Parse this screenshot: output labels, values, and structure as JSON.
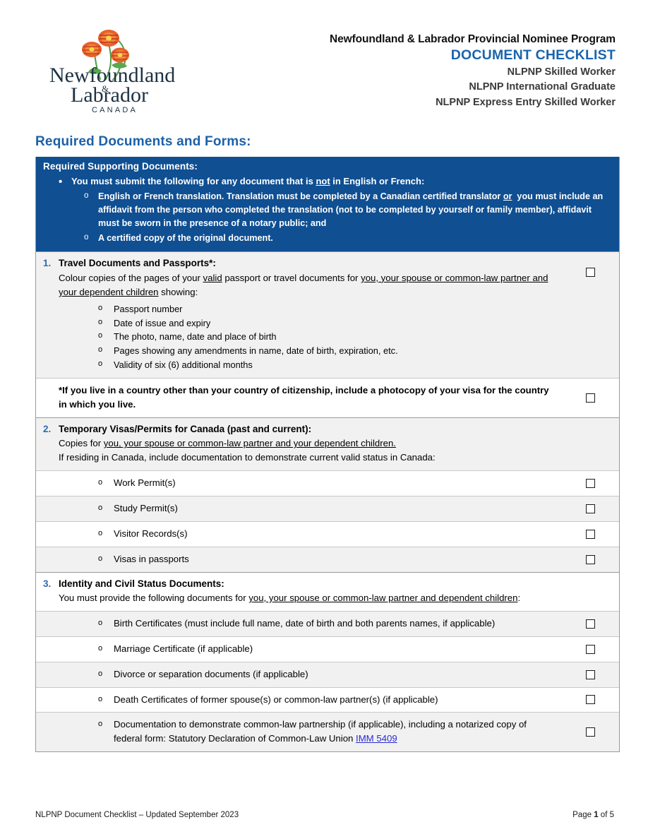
{
  "header": {
    "logo_alt": "Newfoundland & Labrador Canada",
    "logo_line1": "Newfoundland",
    "logo_amp": "&",
    "logo_line2": "Labrador",
    "logo_country": "CANADA",
    "program_title": "Newfoundland & Labrador Provincial Nominee Program",
    "doc_title": "DOCUMENT CHECKLIST",
    "streams": [
      "NLPNP Skilled Worker",
      "NLPNP International Graduate",
      "NLPNP Express Entry Skilled Worker"
    ]
  },
  "section_heading": "Required Documents and Forms:",
  "blue_box": {
    "title": "Required Supporting Documents:",
    "bullet": "You must submit the following for any document that is not in English or French:",
    "bullet_underline": "not",
    "sub_items": [
      "English or French translation. Translation must be completed by a Canadian certified translator or  you must include an affidavit from the person who completed the translation (not to be completed by yourself or family member), affidavit must be sworn in the presence of a notary public; and",
      "A certified copy of the original document."
    ]
  },
  "sections": [
    {
      "num": "1.",
      "title": "Travel Documents and Passports*:",
      "body_pre": "Colour copies of the pages of your ",
      "body_u1": "valid",
      "body_mid": " passport or travel documents for ",
      "body_u2": "you, your spouse or common-law partner and your dependent children",
      "body_post": " showing:",
      "sub_list": [
        "Passport number",
        "Date of issue and expiry",
        "The photo, name, date and place of birth",
        "Pages showing any amendments in name, date of birth, expiration, etc.",
        "Validity of six (6) additional months"
      ]
    },
    {
      "num": "2.",
      "title": "Temporary Visas/Permits for Canada (past and current):",
      "line1_pre": "Copies for ",
      "line1_u": "you, your spouse or common-law partner and your dependent children.",
      "line2": "If residing in Canada, include documentation to demonstrate current valid status in Canada:"
    },
    {
      "num": "3.",
      "title": "Identity and Civil Status Documents:",
      "body_pre": "You must provide the following documents for ",
      "body_u": "you, your spouse or common-law partner and dependent children",
      "body_post": ":"
    }
  ],
  "note_row": {
    "text": "*If you live in a country other than your country of citizenship, include a photocopy of your visa for the country in which you live."
  },
  "section2_items": [
    "Work Permit(s)",
    "Study Permit(s)",
    "Visitor Records(s)",
    "Visas in passports"
  ],
  "section3_items": [
    "Birth Certificates (must include full name, date of birth and both parents names, if applicable)",
    "Marriage Certificate (if applicable)",
    "Divorce or separation documents (if applicable)",
    "Death Certificates of former spouse(s) or common-law partner(s) (if applicable)"
  ],
  "section3_last": {
    "text_pre": "Documentation to demonstrate common-law partnership (if applicable), including a notarized copy of federal form: Statutory Declaration of Common-Law Union ",
    "link": "IMM 5409"
  },
  "footer": {
    "left": "NLPNP Document Checklist – Updated September 2023",
    "right_pre": "Page ",
    "right_num": "1",
    "right_post": " of 5"
  },
  "colors": {
    "brand_blue": "#1c60a8",
    "box_blue": "#0f4f92",
    "link_blue": "#2a2ad0",
    "row_grey": "#f1f1f1"
  }
}
